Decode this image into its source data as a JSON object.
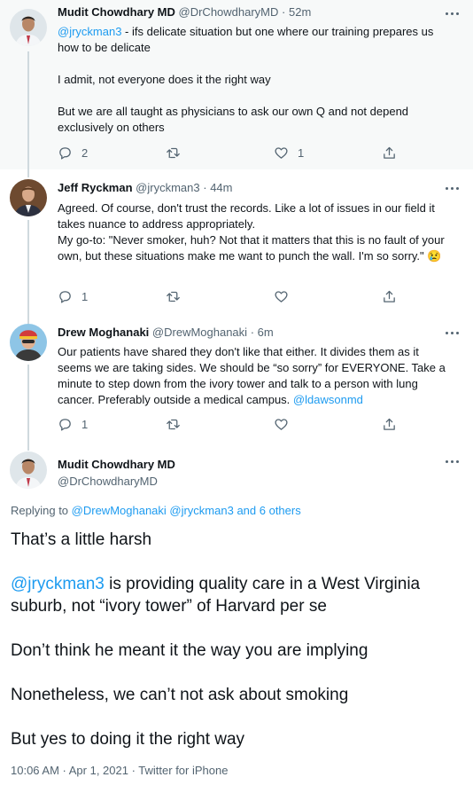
{
  "tweets": [
    {
      "display_name": "Mudit Chowdhary MD",
      "handle": "@DrChowdharyMD",
      "time": "52m",
      "mention": "@jryckman3",
      "text_1": " - ifs delicate situation but one where our training prepares us how to be delicate",
      "text_2": "I admit, not everyone does it the right way",
      "text_3": "But we are all taught as physicians to ask our own Q and not depend exclusively on others",
      "replies": "2",
      "likes": "1"
    },
    {
      "display_name": "Jeff Ryckman",
      "handle": "@jryckman3",
      "time": "44m",
      "text_1": "Agreed. Of course, don't trust the records. Like a lot of issues in our field it takes nuance to address appropriately.",
      "text_2": "My go-to: \"Never smoker, huh? Not that it matters that this is no fault of your own, but these situations make me want to punch the wall. I'm so sorry.\" 😢",
      "replies": "1"
    },
    {
      "display_name": "Drew Moghanaki",
      "handle": "@DrewMoghanaki",
      "time": "6m",
      "text_1": "Our patients have shared they don't like that either. It divides them as it seems we are taking sides. We should be “so sorry” for EVERYONE. Take a minute to step down from the ivory tower and talk to a person with lung cancer. Preferably outside a medical campus. ",
      "mention": "@ldawsonmd",
      "replies": "1"
    }
  ],
  "main_tweet": {
    "display_name": "Mudit Chowdhary MD",
    "handle": "@DrChowdharyMD",
    "replying_prefix": "Replying to ",
    "replying_users": "@DrewMoghanaki @jryckman3 and 6 others",
    "line_1": "That’s a little harsh",
    "mention": "@jryckman3",
    "line_2_rest": " is providing quality care in a West Virginia suburb, not “ivory tower” of Harvard per se",
    "line_3": "Don’t think he meant it the way you are implying",
    "line_4": "Nonetheless, we can’t not ask about smoking",
    "line_5": "But yes to doing it the right way",
    "footer": "10:06 AM · Apr 1, 2021 · Twitter for iPhone"
  },
  "colors": {
    "link": "#1d9bf0",
    "secondary_text": "#536471",
    "thread_line": "#cfd9de",
    "highlight_background": "#f7f9f9"
  },
  "icons": [
    "reply-icon",
    "retweet-icon",
    "like-icon",
    "share-icon",
    "more-icon"
  ]
}
